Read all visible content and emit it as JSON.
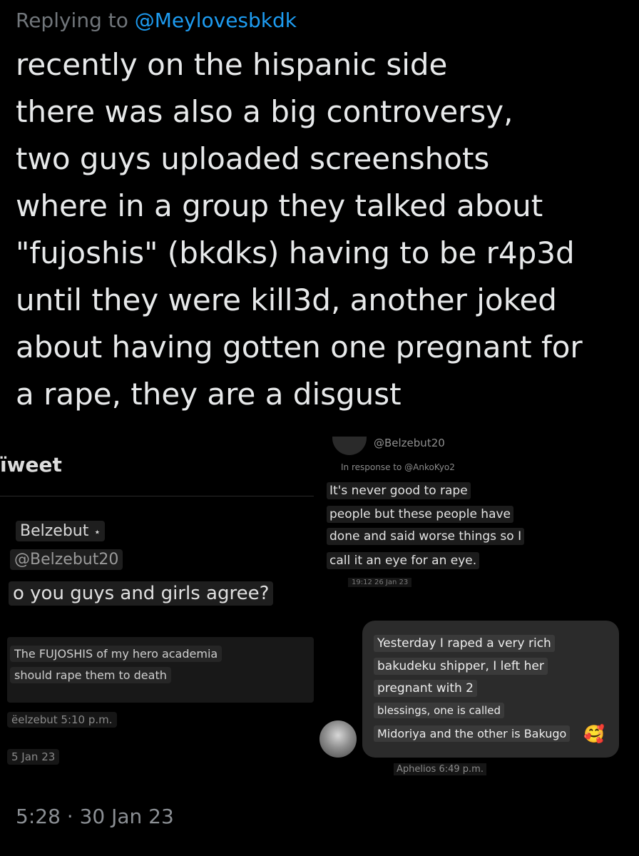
{
  "reply": {
    "prefix": "Replying to",
    "handle": "@Meylovesbkdk"
  },
  "tweet_lines": [
    "recently on the hispanic side",
    "there was also a big controversy,",
    "two guys uploaded screenshots",
    "where in a group they talked about",
    "\"fujoshis\" (bkdks) having to be r4p3d",
    "until they were kill3d, another joked",
    "about having gotten one pregnant for",
    "a rape, they are a disgust"
  ],
  "left_screenshot": {
    "header": "Tweet",
    "header_visible": "ïweet",
    "name": "Belzebut",
    "name_marker": "⋆",
    "handle": "@Belzebut20",
    "question": "o you guys and girls agree?",
    "quote_line1": "The FUJOSHIS of my hero academia",
    "quote_line2": "should rape them to death",
    "time": "ëelzebut 5:10 p.m.",
    "date": "5 Jan 23"
  },
  "right_top_screenshot": {
    "handle": "@Belzebut20",
    "response_to": "In response to @AnkoKyo2",
    "lines": [
      "It's never good to rape",
      "people but these people have",
      "done and said worse things so I",
      "call it an eye for an eye."
    ],
    "timestamp": "19:12 26 Jan 23"
  },
  "right_bottom_dm": {
    "lines": [
      "Yesterday I raped a very rich",
      "bakudeku shipper, I left her",
      "pregnant with 2",
      "blessings, one is called",
      "Midoriya and the other is Bakugo"
    ],
    "emoji": "🥰",
    "meta": "Aphelios 6:49 p.m."
  },
  "footer": {
    "timestamp": "5:28 · 30 Jan 23"
  },
  "colors": {
    "background": "#000000",
    "link": "#1d9bf0",
    "text": "#e7e9ea",
    "muted": "#71767b"
  }
}
